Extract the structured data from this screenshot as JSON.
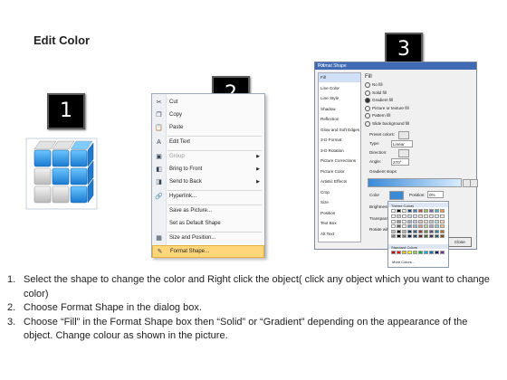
{
  "title": "Edit Color",
  "badges": [
    "1",
    "2",
    "3"
  ],
  "context_menu": {
    "items": [
      {
        "icon": "scissors-icon",
        "glyph": "✂",
        "label": "Cut",
        "submenu": false
      },
      {
        "icon": "copy-icon",
        "glyph": "❐",
        "label": "Copy",
        "submenu": false
      },
      {
        "icon": "paste-icon",
        "glyph": "📋",
        "label": "Paste",
        "submenu": false
      },
      {
        "icon": "edit-text-icon",
        "glyph": "A",
        "label": "Edit Text",
        "submenu": false
      },
      {
        "icon": "group-icon",
        "glyph": "▣",
        "label": "Group",
        "submenu": true,
        "disabled": true
      },
      {
        "icon": "bring-to-front-icon",
        "glyph": "◧",
        "label": "Bring to Front",
        "submenu": true
      },
      {
        "icon": "send-to-back-icon",
        "glyph": "◨",
        "label": "Send to Back",
        "submenu": true
      },
      {
        "icon": "hyperlink-icon",
        "glyph": "🔗",
        "label": "Hyperlink...",
        "submenu": false
      },
      {
        "icon": "",
        "glyph": "",
        "label": "Save as Picture...",
        "submenu": false
      },
      {
        "icon": "",
        "glyph": "",
        "label": "Set as Default Shape",
        "submenu": false
      },
      {
        "icon": "size-position-icon",
        "glyph": "▦",
        "label": "Size and Position...",
        "submenu": false
      },
      {
        "icon": "format-shape-icon",
        "glyph": "✎",
        "label": "Format Shape...",
        "submenu": false,
        "highlighted": true
      }
    ]
  },
  "format_dialog": {
    "title": "Format Shape",
    "controls": "? X",
    "nav": [
      "Fill",
      "Line Color",
      "Line Style",
      "Shadow",
      "Reflection",
      "Glow and Soft Edges",
      "3-D Format",
      "3-D Rotation",
      "Picture Corrections",
      "Picture Color",
      "Artistic Effects",
      "Crop",
      "Size",
      "Position",
      "Text Box",
      "Alt Text"
    ],
    "section": "Fill",
    "options": [
      {
        "label": "No fill",
        "checked": false
      },
      {
        "label": "Solid fill",
        "checked": false
      },
      {
        "label": "Gradient fill",
        "checked": true
      },
      {
        "label": "Picture or texture fill",
        "checked": false
      },
      {
        "label": "Pattern fill",
        "checked": false
      },
      {
        "label": "Slide background fill",
        "checked": false
      }
    ],
    "fields": {
      "preset_label": "Preset colors:",
      "type_label": "Type:",
      "type_value": "Linear",
      "direction_label": "Direction:",
      "angle_label": "Angle:",
      "angle_value": "270°",
      "stops_label": "Gradient stops",
      "color_label": "Color",
      "position_label": "Position:",
      "position_value": "0%",
      "brightness_label": "Brightness:",
      "transparency_label": "Transparency:",
      "rotate_label": "Rotate with shape"
    },
    "close": "Close"
  },
  "palette": {
    "theme_label": "Theme Colors",
    "standard_label": "Standard Colors",
    "more": "More Colors...",
    "theme_top": [
      "#ffffff",
      "#000000",
      "#eeece1",
      "#1f497d",
      "#4f81bd",
      "#c0504d",
      "#9bbb59",
      "#8064a2",
      "#4bacc6",
      "#f79646"
    ],
    "standard": [
      "#c00000",
      "#ff0000",
      "#ffc000",
      "#ffff00",
      "#92d050",
      "#00b050",
      "#00b0f0",
      "#0070c0",
      "#002060",
      "#7030a0"
    ]
  },
  "steps": [
    {
      "num": "1.",
      "text": "Select the shape to change the color and Right click the object( click any object which you want to change color)"
    },
    {
      "num": "2.",
      "text": "Choose Format Shape in the dialog box."
    },
    {
      "num": "3.",
      "text": "Choose “Fill” in the Format Shape box then “Solid” or “Gradient” depending on the appearance of the object. Change colour as shown in the picture."
    }
  ]
}
